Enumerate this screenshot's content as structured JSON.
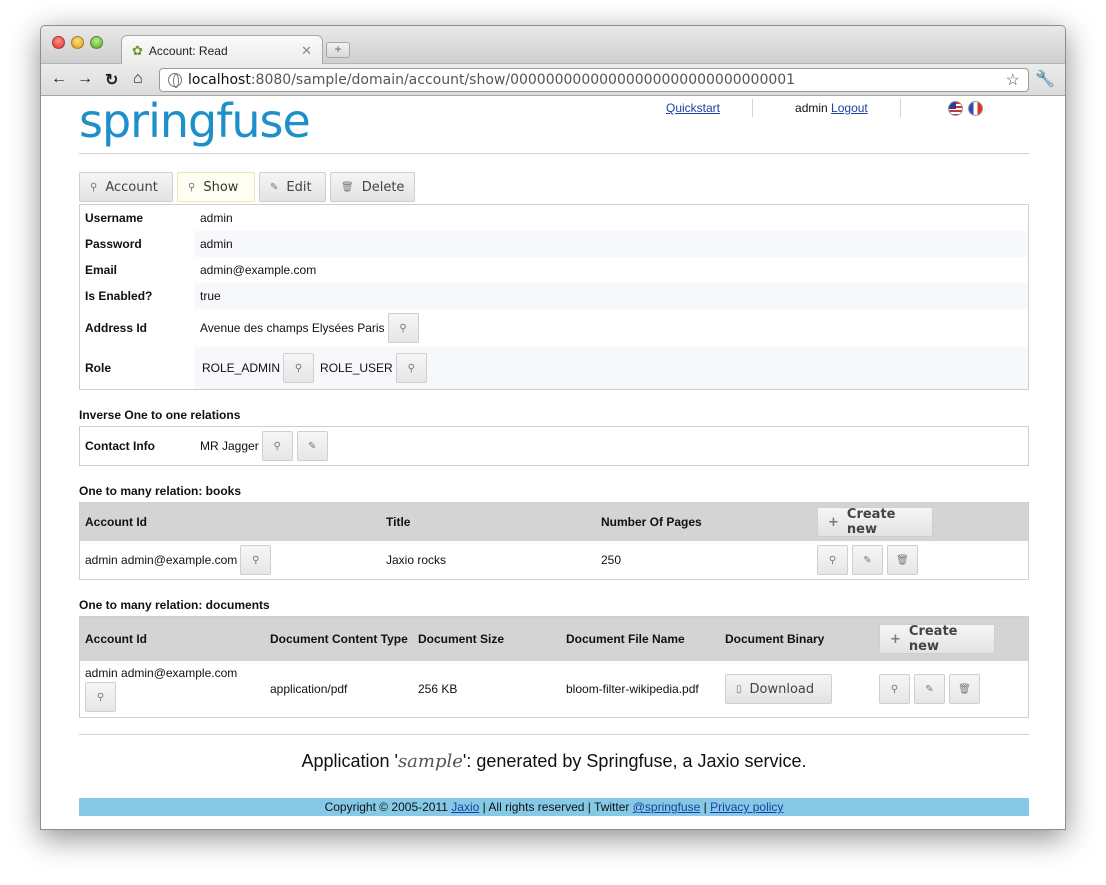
{
  "browser": {
    "tab_title": "Account: Read",
    "url_host": "localhost",
    "url_rest": ":8080/sample/domain/account/show/00000000000000000000000000000001"
  },
  "header": {
    "logo": "springfuse",
    "quickstart": "Quickstart",
    "user": "admin",
    "logout": "Logout"
  },
  "actions": {
    "account": "Account",
    "show": "Show",
    "edit": "Edit",
    "delete": "Delete"
  },
  "account": {
    "username_label": "Username",
    "username": "admin",
    "password_label": "Password",
    "password": "admin",
    "email_label": "Email",
    "email": "admin@example.com",
    "enabled_label": "Is Enabled?",
    "enabled": "true",
    "address_label": "Address Id",
    "address": "Avenue des champs Elysées Paris",
    "role_label": "Role",
    "roles": [
      "ROLE_ADMIN",
      "ROLE_USER"
    ]
  },
  "inverse": {
    "title": "Inverse One to one relations",
    "contact_label": "Contact Info",
    "contact_value": "MR Jagger"
  },
  "books": {
    "title": "One to many relation: books",
    "columns": [
      "Account Id",
      "Title",
      "Number Of Pages"
    ],
    "create_new": "Create new",
    "rows": [
      {
        "account": "admin admin@example.com",
        "title": "Jaxio rocks",
        "pages": "250"
      }
    ]
  },
  "documents": {
    "title": "One to many relation: documents",
    "columns": [
      "Account Id",
      "Document Content Type",
      "Document Size",
      "Document File Name",
      "Document Binary"
    ],
    "create_new": "Create new",
    "download": "Download",
    "rows": [
      {
        "account": "admin admin@example.com",
        "type": "application/pdf",
        "size": "256 KB",
        "file": "bloom-filter-wikipedia.pdf"
      }
    ]
  },
  "footer": {
    "app_prefix": "Application '",
    "app_name": "sample",
    "app_suffix": "': generated by Springfuse, a Jaxio service.",
    "copyright": "Copyright © 2005-2011",
    "jaxio": "Jaxio",
    "rights": "| All rights reserved | Twitter",
    "twitter": "@springfuse",
    "privacy": "Privacy policy"
  }
}
